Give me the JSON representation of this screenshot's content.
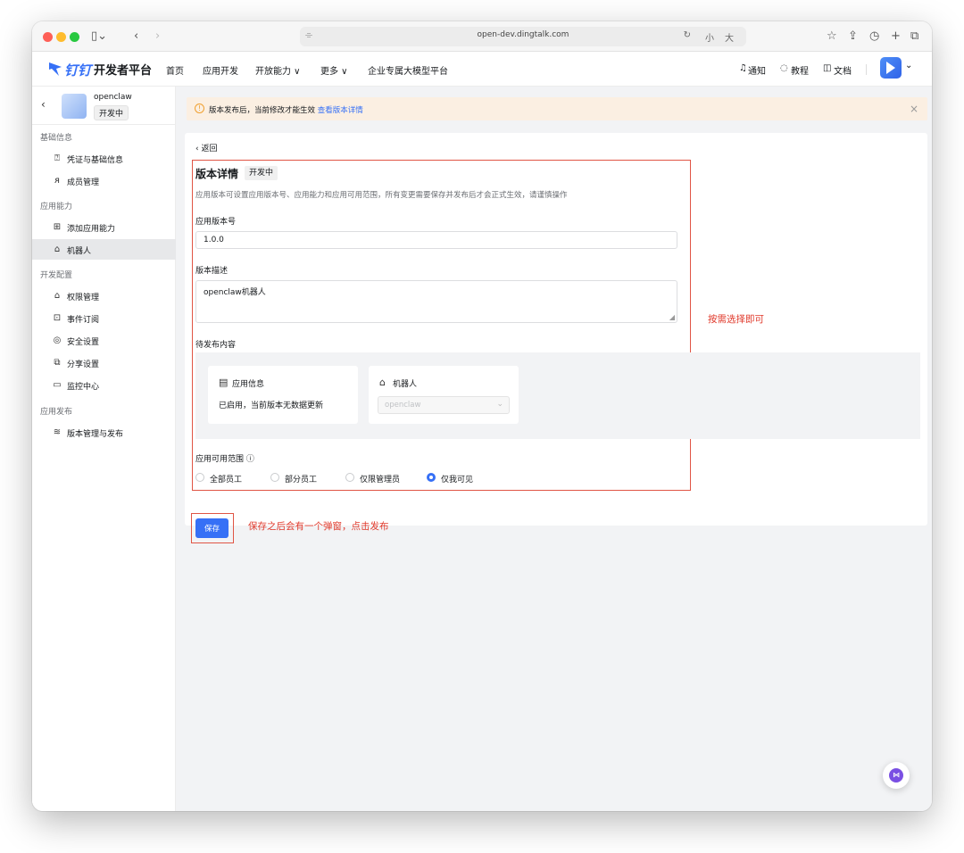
{
  "browser": {
    "url": "open-dev.dingtalk.com",
    "font_small": "小",
    "font_large": "大"
  },
  "header": {
    "logo_text": "钉钉",
    "brand": "开发者平台",
    "nav": [
      {
        "label": "首页"
      },
      {
        "label": "应用开发"
      },
      {
        "label": "开放能力 ∨"
      },
      {
        "label": "更多 ∨"
      },
      {
        "label": "企业专属大模型平台"
      }
    ],
    "notify": "通知",
    "tutorial": "教程",
    "docs": "文档",
    "avatar_caret": "⌄"
  },
  "sidebar": {
    "app_name": "openclaw",
    "app_status": "开发中",
    "sections": [
      {
        "label": "基础信息"
      },
      {
        "label": "应用能力"
      },
      {
        "label": "开发配置"
      },
      {
        "label": "应用发布"
      }
    ],
    "items": [
      {
        "label": "凭证与基础信息",
        "icon": "key-card-icon"
      },
      {
        "label": "成员管理",
        "icon": "user-icon"
      },
      {
        "label": "添加应用能力",
        "icon": "grid-plus-icon"
      },
      {
        "label": "机器人",
        "icon": "robot-icon"
      },
      {
        "label": "权限管理",
        "icon": "lock-icon"
      },
      {
        "label": "事件订阅",
        "icon": "event-icon"
      },
      {
        "label": "安全设置",
        "icon": "shield-icon"
      },
      {
        "label": "分享设置",
        "icon": "share-icon"
      },
      {
        "label": "监控中心",
        "icon": "monitor-icon"
      },
      {
        "label": "版本管理与发布",
        "icon": "layers-icon"
      }
    ],
    "active_item": "机器人"
  },
  "banner": {
    "text": "版本发布后，当前修改才能生效 ",
    "link": "查看版本详情"
  },
  "main": {
    "back": "返回",
    "title": "版本详情",
    "title_tag": "开发中",
    "description": "应用版本可设置应用版本号、应用能力和应用可用范围，所有变更需要保存并发布后才会正式生效，请谨慎操作",
    "version_label": "应用版本号",
    "version_value": "1.0.0",
    "desc_label": "版本描述",
    "desc_value": "openclaw机器人",
    "pending_label": "待发布内容",
    "pending_cards": [
      {
        "title": "应用信息",
        "body": "已启用，当前版本无数据更新"
      },
      {
        "title": "机器人",
        "select_value": "openclaw"
      }
    ],
    "scope_label": "应用可用范围 ⓘ",
    "scope_options": [
      {
        "label": "全部员工",
        "checked": false
      },
      {
        "label": "部分员工",
        "checked": false
      },
      {
        "label": "仅限管理员",
        "checked": false
      },
      {
        "label": "仅我可见",
        "checked": true
      }
    ],
    "save_button": "保存"
  },
  "annotations": {
    "choose_hint": "按需选择即可",
    "save_hint": "保存之后会有一个弹窗，点击发布"
  },
  "colors": {
    "accent": "#3670f6",
    "annotation_red": "#e0392b",
    "banner_bg": "#fbefe2"
  }
}
